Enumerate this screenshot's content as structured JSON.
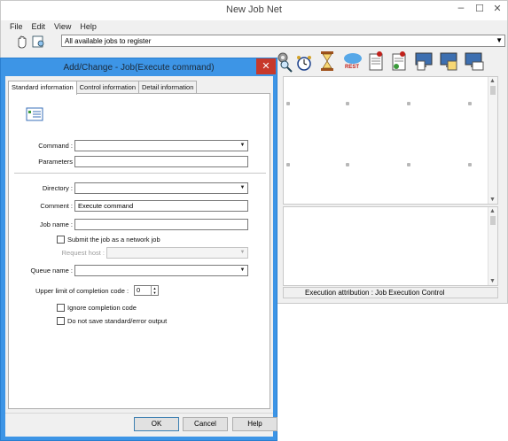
{
  "main_window": {
    "title": "New Job Net",
    "menu": [
      "File",
      "Edit",
      "View",
      "Help"
    ],
    "register_select": {
      "value": "All available jobs to register"
    },
    "toolbar_icons": [
      "hand-icon",
      "job-list-icon",
      "wrench-icon",
      "gear-icon",
      "gear-icon",
      "gear-icon",
      "gear-icon",
      "search-icon",
      "clock-icon",
      "hourglass-icon",
      "rest-icon",
      "document-icon",
      "document-icon",
      "monitor-icon",
      "monitor-icon",
      "monitor-icon"
    ],
    "rest_label": "REST",
    "status_text": "Execution attribution : Job Execution Control"
  },
  "dialog": {
    "title": "Add/Change - Job(Execute command)",
    "close_glyph": "✕",
    "tabs": [
      "Standard information",
      "Control information",
      "Detail information"
    ],
    "fields": {
      "command_label": "Command :",
      "command_value": "",
      "parameters_label": "Parameters",
      "parameters_value": "",
      "directory_label": "Directory :",
      "directory_value": "",
      "comment_label": "Comment :",
      "comment_value": "Execute command",
      "jobname_label": "Job name :",
      "jobname_value": "",
      "network_job_label": "Submit the job as a network job",
      "request_host_label": "Request host :",
      "request_host_value": "",
      "queue_label": "Queue name :",
      "queue_value": "",
      "completion_code_label": "Upper limit of completion code :",
      "completion_code_value": "0",
      "ignore_completion_label": "Ignore completion code",
      "no_save_label": "Do not save standard/error output"
    },
    "buttons": {
      "ok": "OK",
      "cancel": "Cancel",
      "help": "Help"
    }
  },
  "colors": {
    "dialog_frame": "#3d95e6",
    "close_button": "#c7392b",
    "window_bg": "#f0f0f0"
  }
}
